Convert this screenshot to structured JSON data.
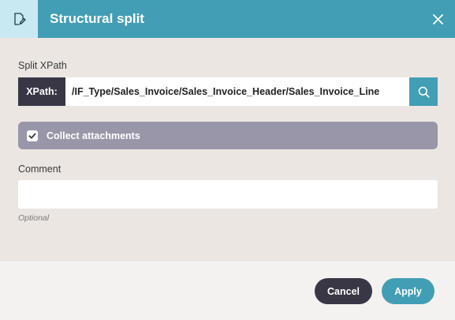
{
  "dialog": {
    "title": "Structural split",
    "header_icon": "document-edit-icon",
    "close_icon": "close-icon"
  },
  "xpath": {
    "label": "Split XPath",
    "prefix": "XPath:",
    "value": "/IF_Type/Sales_Invoice/Sales_Invoice_Header/Sales_Invoice_Line",
    "search_icon": "search-icon"
  },
  "attachments": {
    "label": "Collect attachments",
    "checked": true
  },
  "comment": {
    "label": "Comment",
    "value": "",
    "hint": "Optional"
  },
  "footer": {
    "cancel_label": "Cancel",
    "apply_label": "Apply"
  },
  "colors": {
    "header": "#429eb4",
    "header_icon_bg": "#c9e9f2",
    "dark": "#393646",
    "attachments_bg": "#9896a8",
    "body_bg": "#ebe6e2",
    "footer_bg": "#f4f2f0"
  }
}
